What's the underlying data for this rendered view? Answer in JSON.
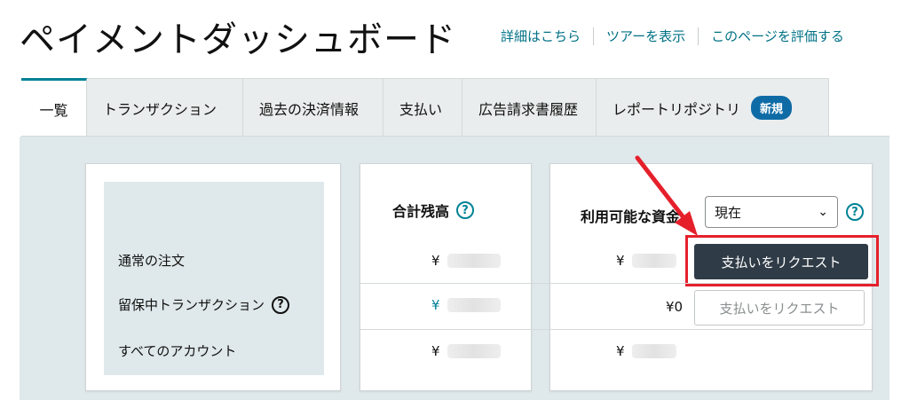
{
  "header": {
    "title": "ペイメントダッシュボード",
    "links": [
      "詳細はこちら",
      "ツアーを表示",
      "このページを評価する"
    ]
  },
  "tabs": [
    {
      "label": "一覧",
      "active": true
    },
    {
      "label": "トランザクション"
    },
    {
      "label": "過去の決済情報"
    },
    {
      "label": "支払い"
    },
    {
      "label": "広告請求書履歴"
    },
    {
      "label": "レポートリポジトリ",
      "badge": "新規"
    }
  ],
  "rows": {
    "normal_orders": "通常の注文",
    "pending_transactions": "留保中トランザクション",
    "all_accounts": "すべてのアカウント"
  },
  "total_balance": {
    "title": "合計残高",
    "currency": "¥"
  },
  "available_funds": {
    "title": "利用可能な資金",
    "period_selected": "現在",
    "currency": "¥",
    "pending_amount": "¥0",
    "request_payout_label": "支払いをリクエスト",
    "request_payout_disabled_label": "支払いをリクエスト"
  },
  "icons": {
    "help": "?",
    "chevron": "⌄"
  },
  "colors": {
    "accent_teal": "#008296",
    "primary_button": "#2f3b46",
    "highlight_red": "#e5202b",
    "badge_blue": "#0f6ba6"
  }
}
